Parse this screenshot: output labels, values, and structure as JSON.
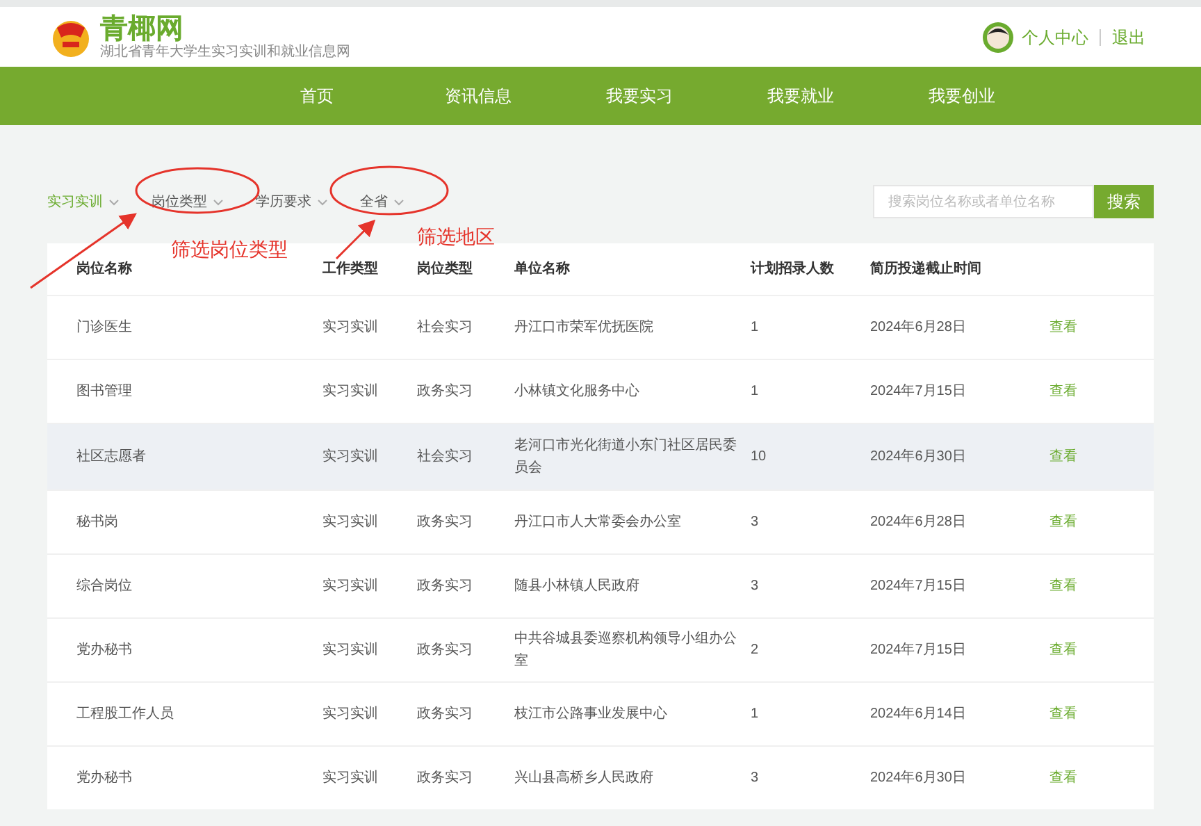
{
  "header": {
    "site_name": "青椰网",
    "subtitle": "湖北省青年大学生实习实训和就业信息网",
    "user_link": "个人中心",
    "logout": "退出"
  },
  "nav": [
    "首页",
    "资讯信息",
    "我要实习",
    "我要就业",
    "我要创业"
  ],
  "filters": [
    {
      "label": "实习实训",
      "selected": true
    },
    {
      "label": "岗位类型",
      "selected": false
    },
    {
      "label": "学历要求",
      "selected": false
    },
    {
      "label": "全省",
      "selected": false
    }
  ],
  "search": {
    "placeholder": "搜索岗位名称或者单位名称",
    "button": "搜索"
  },
  "annotations": [
    {
      "text": "筛选岗位类型"
    },
    {
      "text": "筛选地区"
    }
  ],
  "table": {
    "columns": [
      "岗位名称",
      "工作类型",
      "岗位类型",
      "单位名称",
      "计划招录人数",
      "简历投递截止时间"
    ],
    "rows": [
      {
        "cells": [
          "门诊医生",
          "实习实训",
          "社会实习",
          "丹江口市荣军优抚医院",
          "1",
          "2024年6月28日"
        ],
        "action": "查看",
        "highlighted": false
      },
      {
        "cells": [
          "图书管理",
          "实习实训",
          "政务实习",
          "小林镇文化服务中心",
          "1",
          "2024年7月15日"
        ],
        "action": "查看",
        "highlighted": false
      },
      {
        "cells": [
          "社区志愿者",
          "实习实训",
          "社会实习",
          "老河口市光化街道小东门社区居民委员会",
          "10",
          "2024年6月30日"
        ],
        "action": "查看",
        "highlighted": true
      },
      {
        "cells": [
          "秘书岗",
          "实习实训",
          "政务实习",
          "丹江口市人大常委会办公室",
          "3",
          "2024年6月28日"
        ],
        "action": "查看",
        "highlighted": false
      },
      {
        "cells": [
          "综合岗位",
          "实习实训",
          "政务实习",
          "随县小林镇人民政府",
          "3",
          "2024年7月15日"
        ],
        "action": "查看",
        "highlighted": false
      },
      {
        "cells": [
          "党办秘书",
          "实习实训",
          "政务实习",
          "中共谷城县委巡察机构领导小组办公室",
          "2",
          "2024年7月15日"
        ],
        "action": "查看",
        "highlighted": false
      },
      {
        "cells": [
          "工程股工作人员",
          "实习实训",
          "政务实习",
          "枝江市公路事业发展中心",
          "1",
          "2024年6月14日"
        ],
        "action": "查看",
        "highlighted": false
      },
      {
        "cells": [
          "党办秘书",
          "实习实训",
          "政务实习",
          "兴山县高桥乡人民政府",
          "3",
          "2024年6月30日"
        ],
        "action": "查看",
        "highlighted": false
      }
    ]
  }
}
